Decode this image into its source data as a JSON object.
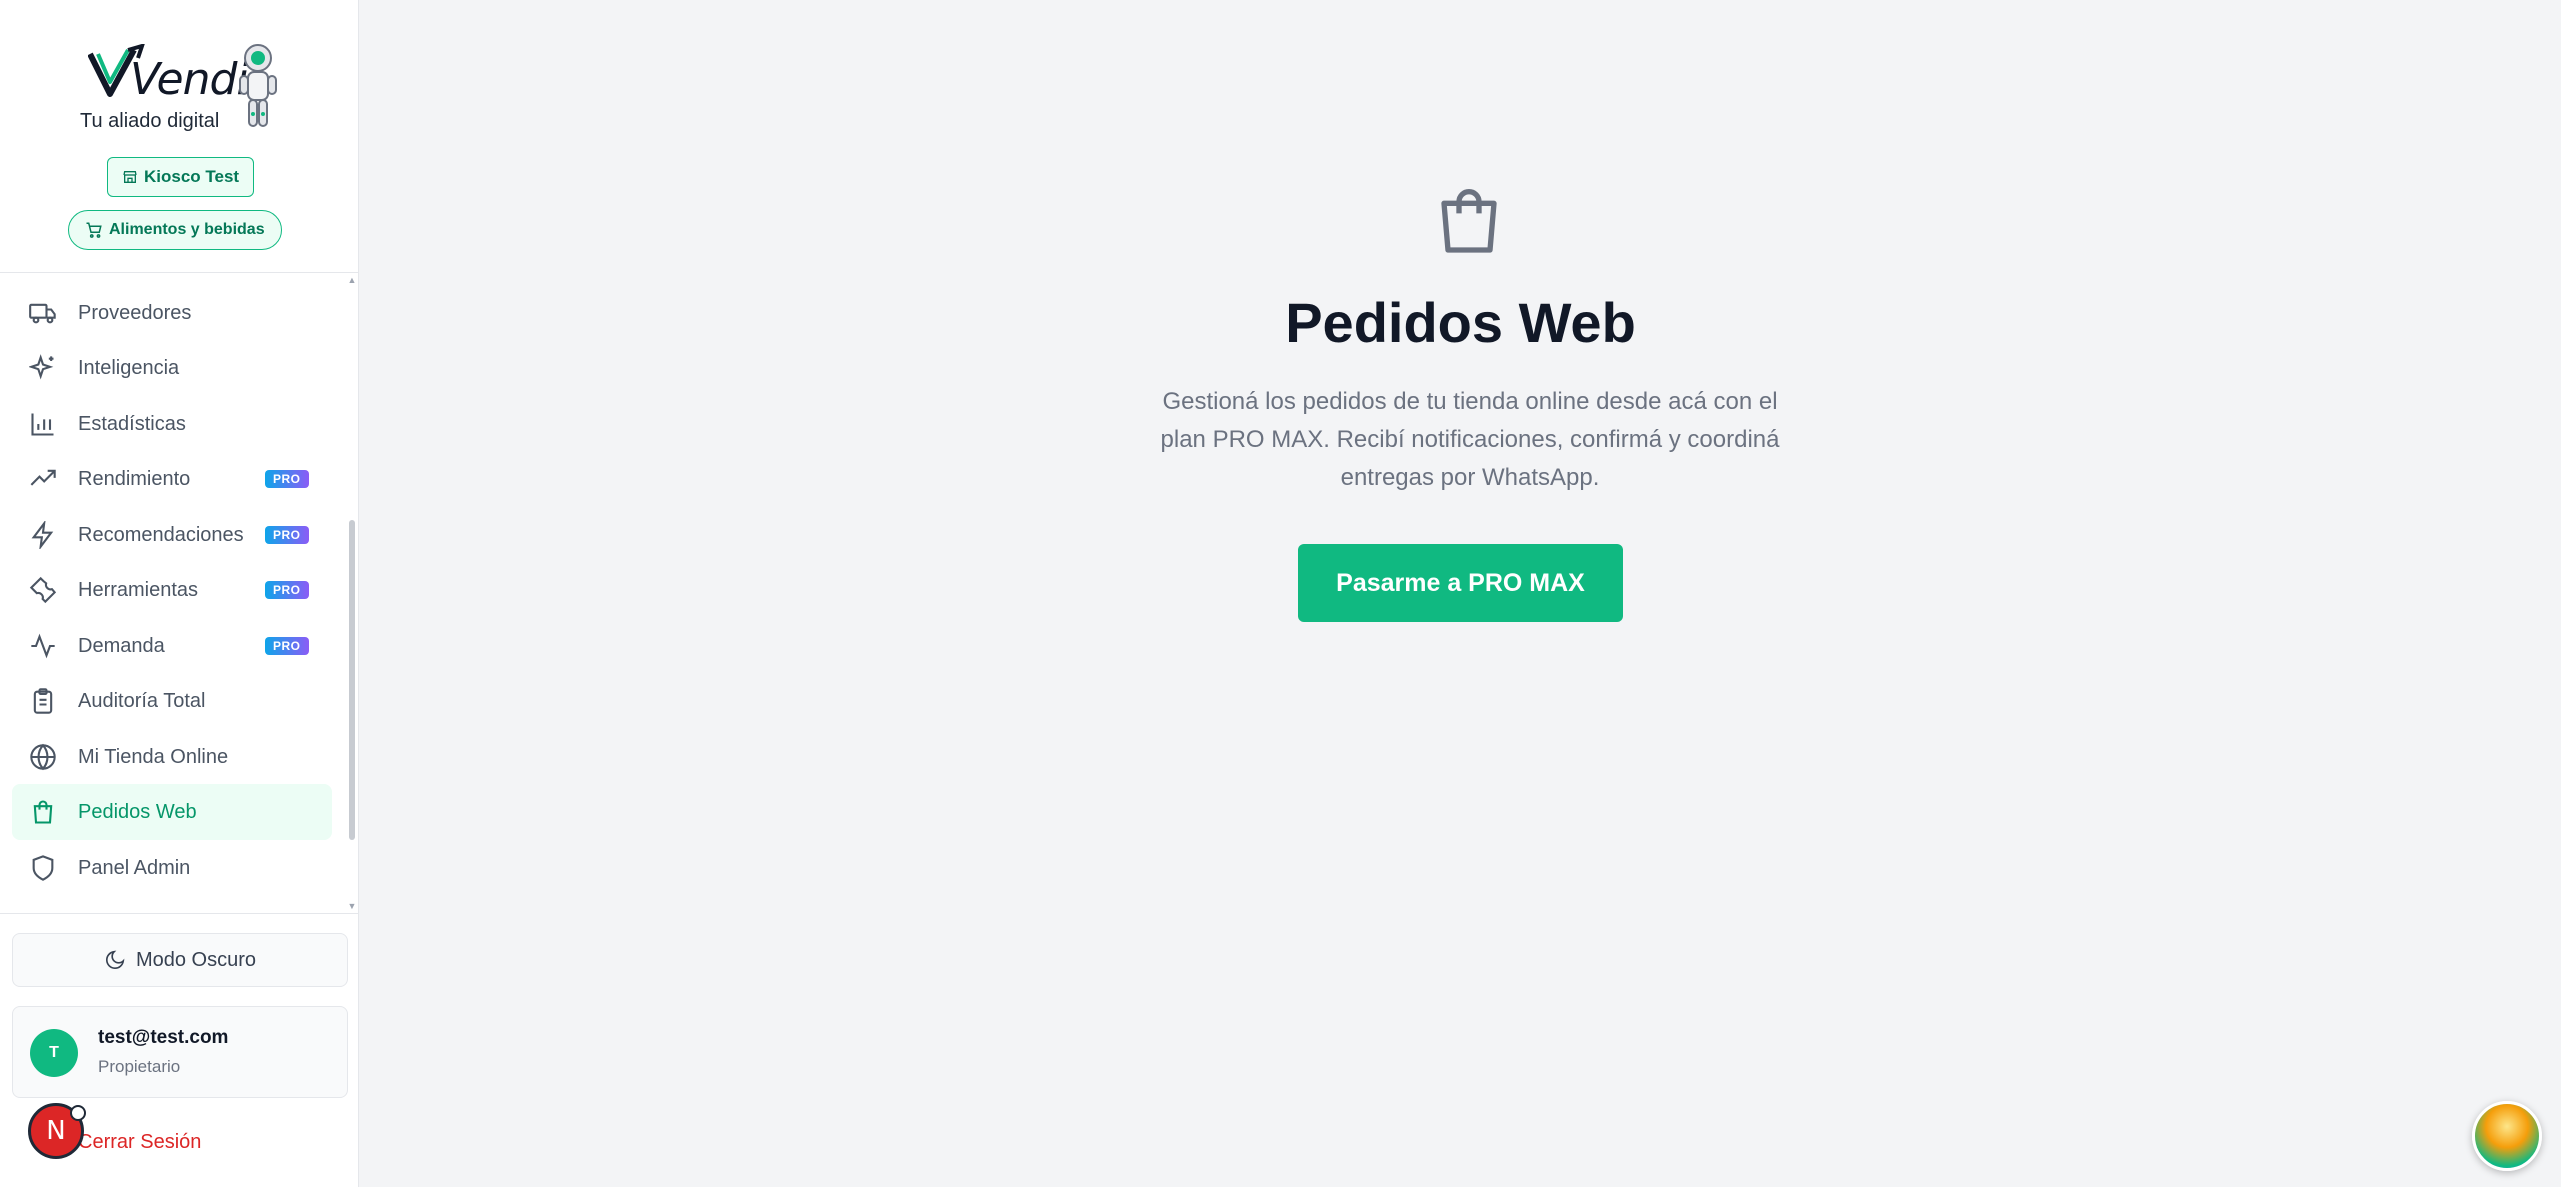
{
  "brand": {
    "logo_text": "Vendi",
    "tagline": "Tu aliado digital",
    "store_label": "Kiosco Test",
    "category_label": "Alimentos y bebidas"
  },
  "nav": {
    "items": [
      {
        "label": "Proveedores",
        "icon": "truck-icon",
        "pro": false
      },
      {
        "label": "Inteligencia",
        "icon": "sparkles-icon",
        "pro": false
      },
      {
        "label": "Estadísticas",
        "icon": "bar-chart-icon",
        "pro": false
      },
      {
        "label": "Rendimiento",
        "icon": "trending-up-icon",
        "pro": true
      },
      {
        "label": "Recomendaciones",
        "icon": "zap-icon",
        "pro": true
      },
      {
        "label": "Herramientas",
        "icon": "wrench-icon",
        "pro": true
      },
      {
        "label": "Demanda",
        "icon": "activity-icon",
        "pro": true
      },
      {
        "label": "Auditoría Total",
        "icon": "clipboard-icon",
        "pro": false
      },
      {
        "label": "Mi Tienda Online",
        "icon": "globe-icon",
        "pro": false
      },
      {
        "label": "Pedidos Web",
        "icon": "shopping-bag-icon",
        "pro": false,
        "active": true
      },
      {
        "label": "Panel Admin",
        "icon": "shield-icon",
        "pro": false
      }
    ],
    "pro_badge_label": "PRO"
  },
  "footer": {
    "dark_mode_label": "Modo Oscuro",
    "user_initial": "T",
    "user_email": "test@test.com",
    "user_role": "Propietario",
    "logout_label": "Cerrar Sesión",
    "dev_badge_letter": "N"
  },
  "main": {
    "title": "Pedidos Web",
    "description": "Gestioná los pedidos de tu tienda online desde acá con el plan PRO MAX. Recibí notificaciones, confirmá y coordiná entregas por WhatsApp.",
    "cta_label": "Pasarme a PRO MAX"
  },
  "colors": {
    "accent": "#10b981",
    "accent_dark": "#059669",
    "logout": "#dc2626",
    "background": "#f3f4f6"
  }
}
